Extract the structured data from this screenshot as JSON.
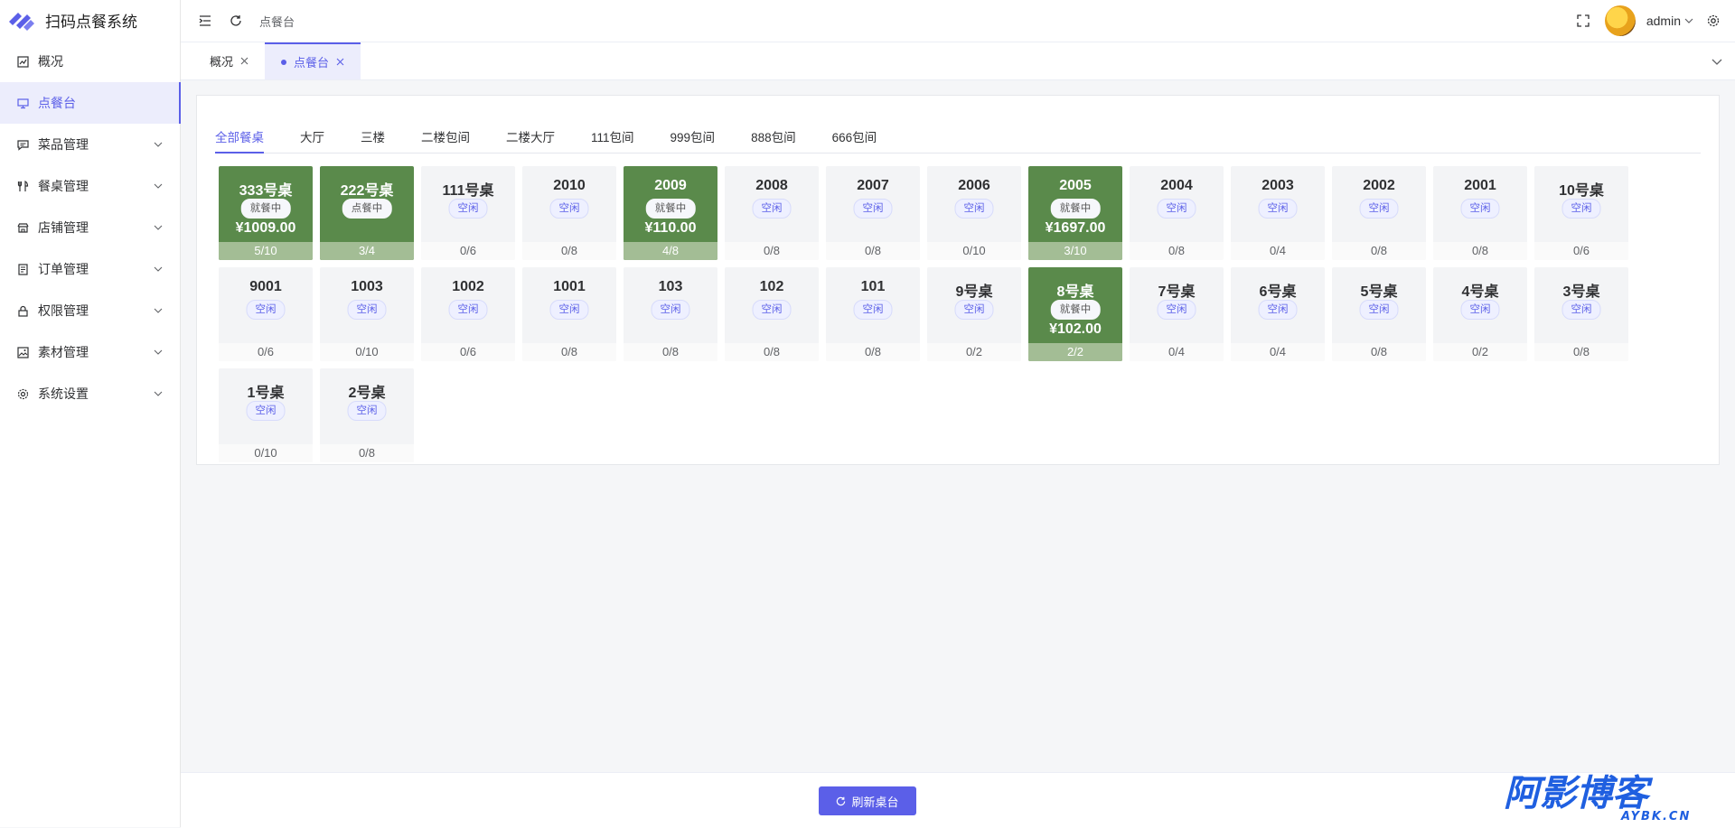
{
  "app": {
    "title": "扫码点餐系统"
  },
  "sidebar": {
    "items": [
      {
        "label": "概况",
        "icon": "chart-icon",
        "has_children": false,
        "active": false
      },
      {
        "label": "点餐台",
        "icon": "monitor-icon",
        "has_children": false,
        "active": true
      },
      {
        "label": "菜品管理",
        "icon": "message-icon",
        "has_children": true,
        "active": false
      },
      {
        "label": "餐桌管理",
        "icon": "utensils-icon",
        "has_children": true,
        "active": false
      },
      {
        "label": "店铺管理",
        "icon": "shop-icon",
        "has_children": true,
        "active": false
      },
      {
        "label": "订单管理",
        "icon": "document-icon",
        "has_children": true,
        "active": false
      },
      {
        "label": "权限管理",
        "icon": "lock-icon",
        "has_children": true,
        "active": false
      },
      {
        "label": "素材管理",
        "icon": "picture-icon",
        "has_children": true,
        "active": false
      },
      {
        "label": "系统设置",
        "icon": "gear-icon",
        "has_children": true,
        "active": false
      }
    ]
  },
  "header": {
    "breadcrumb": "点餐台",
    "user": "admin"
  },
  "page_tabs": [
    {
      "label": "概况",
      "active": false
    },
    {
      "label": "点餐台",
      "active": true
    }
  ],
  "area_tabs": [
    "全部餐桌",
    "大厅",
    "三楼",
    "二楼包间",
    "二楼大厅",
    "111包间",
    "999包间",
    "888包间",
    "666包间"
  ],
  "tables": [
    {
      "name": "333号桌",
      "status": "就餐中",
      "amount": "¥1009.00",
      "seats": "5/10",
      "busy": true
    },
    {
      "name": "222号桌",
      "status": "点餐中",
      "amount": "",
      "seats": "3/4",
      "busy": true
    },
    {
      "name": "111号桌",
      "status": "空闲",
      "amount": "",
      "seats": "0/6",
      "busy": false
    },
    {
      "name": "2010",
      "status": "空闲",
      "amount": "",
      "seats": "0/8",
      "busy": false
    },
    {
      "name": "2009",
      "status": "就餐中",
      "amount": "¥110.00",
      "seats": "4/8",
      "busy": true
    },
    {
      "name": "2008",
      "status": "空闲",
      "amount": "",
      "seats": "0/8",
      "busy": false
    },
    {
      "name": "2007",
      "status": "空闲",
      "amount": "",
      "seats": "0/8",
      "busy": false
    },
    {
      "name": "2006",
      "status": "空闲",
      "amount": "",
      "seats": "0/10",
      "busy": false
    },
    {
      "name": "2005",
      "status": "就餐中",
      "amount": "¥1697.00",
      "seats": "3/10",
      "busy": true
    },
    {
      "name": "2004",
      "status": "空闲",
      "amount": "",
      "seats": "0/8",
      "busy": false
    },
    {
      "name": "2003",
      "status": "空闲",
      "amount": "",
      "seats": "0/4",
      "busy": false
    },
    {
      "name": "2002",
      "status": "空闲",
      "amount": "",
      "seats": "0/8",
      "busy": false
    },
    {
      "name": "2001",
      "status": "空闲",
      "amount": "",
      "seats": "0/8",
      "busy": false
    },
    {
      "name": "10号桌",
      "status": "空闲",
      "amount": "",
      "seats": "0/6",
      "busy": false
    },
    {
      "name": "9001",
      "status": "空闲",
      "amount": "",
      "seats": "0/6",
      "busy": false
    },
    {
      "name": "1003",
      "status": "空闲",
      "amount": "",
      "seats": "0/10",
      "busy": false
    },
    {
      "name": "1002",
      "status": "空闲",
      "amount": "",
      "seats": "0/6",
      "busy": false
    },
    {
      "name": "1001",
      "status": "空闲",
      "amount": "",
      "seats": "0/8",
      "busy": false
    },
    {
      "name": "103",
      "status": "空闲",
      "amount": "",
      "seats": "0/8",
      "busy": false
    },
    {
      "name": "102",
      "status": "空闲",
      "amount": "",
      "seats": "0/8",
      "busy": false
    },
    {
      "name": "101",
      "status": "空闲",
      "amount": "",
      "seats": "0/8",
      "busy": false
    },
    {
      "name": "9号桌",
      "status": "空闲",
      "amount": "",
      "seats": "0/2",
      "busy": false
    },
    {
      "name": "8号桌",
      "status": "就餐中",
      "amount": "¥102.00",
      "seats": "2/2",
      "busy": true
    },
    {
      "name": "7号桌",
      "status": "空闲",
      "amount": "",
      "seats": "0/4",
      "busy": false
    },
    {
      "name": "6号桌",
      "status": "空闲",
      "amount": "",
      "seats": "0/4",
      "busy": false
    },
    {
      "name": "5号桌",
      "status": "空闲",
      "amount": "",
      "seats": "0/8",
      "busy": false
    },
    {
      "name": "4号桌",
      "status": "空闲",
      "amount": "",
      "seats": "0/2",
      "busy": false
    },
    {
      "name": "3号桌",
      "status": "空闲",
      "amount": "",
      "seats": "0/8",
      "busy": false
    },
    {
      "name": "1号桌",
      "status": "空闲",
      "amount": "",
      "seats": "0/10",
      "busy": false
    },
    {
      "name": "2号桌",
      "status": "空闲",
      "amount": "",
      "seats": "0/8",
      "busy": false
    }
  ],
  "footer": {
    "refresh_label": "刷新桌台"
  },
  "watermark": {
    "main": "阿影博客",
    "sub": "AYBK.CN"
  },
  "colors": {
    "accent": "#5b5fe8",
    "busy": "#5a8a4b",
    "busy_light": "#a3bd95",
    "watermark": "#1f5fe0"
  }
}
